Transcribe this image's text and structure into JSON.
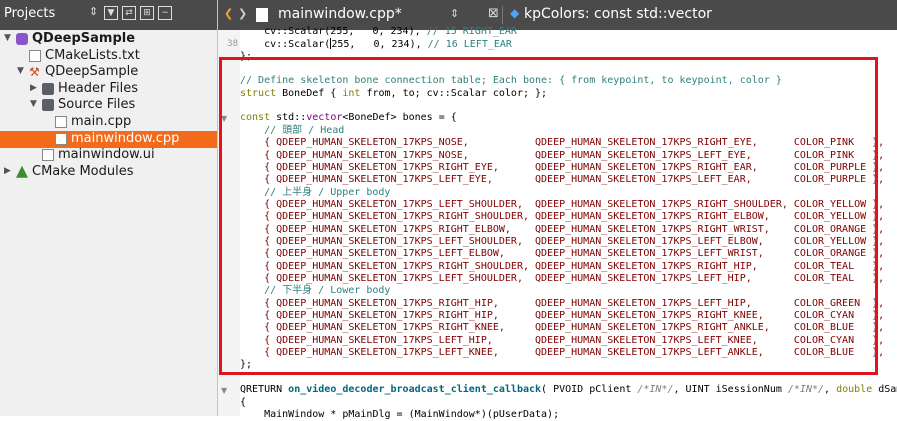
{
  "sidebar": {
    "title": "Projects",
    "tree": [
      {
        "label": "QDeepSample",
        "icon": "project-icon",
        "bold": true,
        "level": 0,
        "expanded": true
      },
      {
        "label": "CMakeLists.txt",
        "icon": "cmake-file-icon",
        "level": 1
      },
      {
        "label": "QDeepSample",
        "icon": "hammer-icon",
        "level": 1,
        "expanded": true
      },
      {
        "label": "Header Files",
        "icon": "folder-icon",
        "level": 2,
        "expanded": false
      },
      {
        "label": "Source Files",
        "icon": "folder-icon",
        "level": 2,
        "expanded": true
      },
      {
        "label": "main.cpp",
        "icon": "cpp-file-icon",
        "level": 3
      },
      {
        "label": "mainwindow.cpp",
        "icon": "cpp-file-icon",
        "level": 3,
        "selected": true
      },
      {
        "label": "mainwindow.ui",
        "icon": "ui-file-icon",
        "level": 2
      },
      {
        "label": "CMake Modules",
        "icon": "cmake-modules-icon",
        "level": 0,
        "expanded": false
      }
    ]
  },
  "editor": {
    "filename": "mainwindow.cpp*",
    "symbol": "kpColors: const std::vector",
    "code": [
      {
        "ln": "",
        "t": [
          [
            "    cv::Scalar(255,   0, 234), ",
            ""
          ],
          [
            "// 15 RIGHT_EAR",
            "cm"
          ]
        ]
      },
      {
        "ln": "38",
        "t": [
          [
            "    cv::Scalar(",
            ""
          ],
          [
            "|",
            "cursor"
          ],
          [
            "255,   0, 234), ",
            ""
          ],
          [
            "// 16 LEFT_EAR",
            "cm"
          ]
        ]
      },
      {
        "ln": "",
        "t": [
          [
            "};",
            ""
          ]
        ]
      },
      {
        "ln": "",
        "t": [
          [
            "",
            ""
          ]
        ]
      },
      {
        "ln": "",
        "t": [
          [
            "// Define skeleton bone connection table; Each bone: { from keypoint, to keypoint, color }",
            "cm"
          ]
        ]
      },
      {
        "ln": "",
        "t": [
          [
            "struct",
            "kw"
          ],
          [
            " BoneDef { ",
            ""
          ],
          [
            "int",
            "kw"
          ],
          [
            " from, to; cv::Scalar color; };",
            ""
          ]
        ]
      },
      {
        "ln": "",
        "t": [
          [
            "",
            ""
          ]
        ]
      },
      {
        "ln": "",
        "fold": true,
        "t": [
          [
            "const",
            "kw"
          ],
          [
            " std::",
            ""
          ],
          [
            "vector",
            "ty"
          ],
          [
            "<BoneDef> bones = {",
            ""
          ]
        ]
      },
      {
        "ln": "",
        "t": [
          [
            "    ",
            ""
          ],
          [
            "// 頭部 / Head",
            "cm"
          ]
        ]
      },
      {
        "ln": "",
        "t": [
          [
            "    { QDEEP_HUMAN_SKELETON_17KPS_NOSE,           QDEEP_HUMAN_SKELETON_17KPS_RIGHT_EYE,      COLOR_PINK   },",
            "en"
          ]
        ]
      },
      {
        "ln": "",
        "t": [
          [
            "    { QDEEP_HUMAN_SKELETON_17KPS_NOSE,           QDEEP_HUMAN_SKELETON_17KPS_LEFT_EYE,       COLOR_PINK   },",
            "en"
          ]
        ]
      },
      {
        "ln": "",
        "t": [
          [
            "    { QDEEP_HUMAN_SKELETON_17KPS_RIGHT_EYE,      QDEEP_HUMAN_SKELETON_17KPS_RIGHT_EAR,      COLOR_PURPLE },",
            "en"
          ]
        ]
      },
      {
        "ln": "",
        "t": [
          [
            "    { QDEEP_HUMAN_SKELETON_17KPS_LEFT_EYE,       QDEEP_HUMAN_SKELETON_17KPS_LEFT_EAR,       COLOR_PURPLE },",
            "en"
          ]
        ]
      },
      {
        "ln": "",
        "t": [
          [
            "    ",
            ""
          ],
          [
            "// 上半身 / Upper body",
            "cm"
          ]
        ]
      },
      {
        "ln": "",
        "t": [
          [
            "    { QDEEP_HUMAN_SKELETON_17KPS_LEFT_SHOULDER,  QDEEP_HUMAN_SKELETON_17KPS_RIGHT_SHOULDER, COLOR_YELLOW },",
            "en"
          ]
        ]
      },
      {
        "ln": "",
        "t": [
          [
            "    { QDEEP_HUMAN_SKELETON_17KPS_RIGHT_SHOULDER, QDEEP_HUMAN_SKELETON_17KPS_RIGHT_ELBOW,    COLOR_YELLOW },",
            "en"
          ]
        ]
      },
      {
        "ln": "",
        "t": [
          [
            "    { QDEEP_HUMAN_SKELETON_17KPS_RIGHT_ELBOW,    QDEEP_HUMAN_SKELETON_17KPS_RIGHT_WRIST,    COLOR_ORANGE },",
            "en"
          ]
        ]
      },
      {
        "ln": "",
        "t": [
          [
            "    { QDEEP_HUMAN_SKELETON_17KPS_LEFT_SHOULDER,  QDEEP_HUMAN_SKELETON_17KPS_LEFT_ELBOW,     COLOR_YELLOW },",
            "en"
          ]
        ]
      },
      {
        "ln": "",
        "t": [
          [
            "    { QDEEP_HUMAN_SKELETON_17KPS_LEFT_ELBOW,     QDEEP_HUMAN_SKELETON_17KPS_LEFT_WRIST,     COLOR_ORANGE },",
            "en"
          ]
        ]
      },
      {
        "ln": "",
        "t": [
          [
            "    { QDEEP_HUMAN_SKELETON_17KPS_RIGHT_SHOULDER, QDEEP_HUMAN_SKELETON_17KPS_RIGHT_HIP,      COLOR_TEAL   },",
            "en"
          ]
        ]
      },
      {
        "ln": "",
        "t": [
          [
            "    { QDEEP_HUMAN_SKELETON_17KPS_LEFT_SHOULDER,  QDEEP_HUMAN_SKELETON_17KPS_LEFT_HIP,       COLOR_TEAL   },",
            "en"
          ]
        ]
      },
      {
        "ln": "",
        "t": [
          [
            "    ",
            ""
          ],
          [
            "// 下半身 / Lower body",
            "cm"
          ]
        ]
      },
      {
        "ln": "",
        "t": [
          [
            "    { QDEEP_HUMAN_SKELETON_17KPS_RIGHT_HIP,      QDEEP_HUMAN_SKELETON_17KPS_LEFT_HIP,       COLOR_GREEN  },",
            "en"
          ]
        ]
      },
      {
        "ln": "",
        "t": [
          [
            "    { QDEEP_HUMAN_SKELETON_17KPS_RIGHT_HIP,      QDEEP_HUMAN_SKELETON_17KPS_RIGHT_KNEE,     COLOR_CYAN   },",
            "en"
          ]
        ]
      },
      {
        "ln": "",
        "t": [
          [
            "    { QDEEP_HUMAN_SKELETON_17KPS_RIGHT_KNEE,     QDEEP_HUMAN_SKELETON_17KPS_RIGHT_ANKLE,    COLOR_BLUE   },",
            "en"
          ]
        ]
      },
      {
        "ln": "",
        "t": [
          [
            "    { QDEEP_HUMAN_SKELETON_17KPS_LEFT_HIP,       QDEEP_HUMAN_SKELETON_17KPS_LEFT_KNEE,      COLOR_CYAN   },",
            "en"
          ]
        ]
      },
      {
        "ln": "",
        "t": [
          [
            "    { QDEEP_HUMAN_SKELETON_17KPS_LEFT_KNEE,      QDEEP_HUMAN_SKELETON_17KPS_LEFT_ANKLE,     COLOR_BLUE   },",
            "en"
          ]
        ]
      },
      {
        "ln": "",
        "t": [
          [
            "};",
            ""
          ]
        ]
      },
      {
        "ln": "",
        "t": [
          [
            "",
            ""
          ]
        ]
      },
      {
        "ln": "",
        "fold": true,
        "t": [
          [
            "QRETURN ",
            ""
          ],
          [
            "on_video_decoder_broadcast_client_callback",
            "fn"
          ],
          [
            "( PVOID pClient ",
            ""
          ],
          [
            "/*IN*/",
            "ucm"
          ],
          [
            ", UINT iSessionNum ",
            ""
          ],
          [
            "/*IN*/",
            "ucm"
          ],
          [
            ", ",
            ""
          ],
          [
            "double",
            "kw"
          ],
          [
            " dSampleT",
            ""
          ]
        ]
      },
      {
        "ln": "",
        "t": [
          [
            "{",
            ""
          ]
        ]
      },
      {
        "ln": "",
        "t": [
          [
            "    MainWindow * pMainDlg = (MainWindow*)(pUserData);",
            ""
          ]
        ]
      }
    ]
  }
}
